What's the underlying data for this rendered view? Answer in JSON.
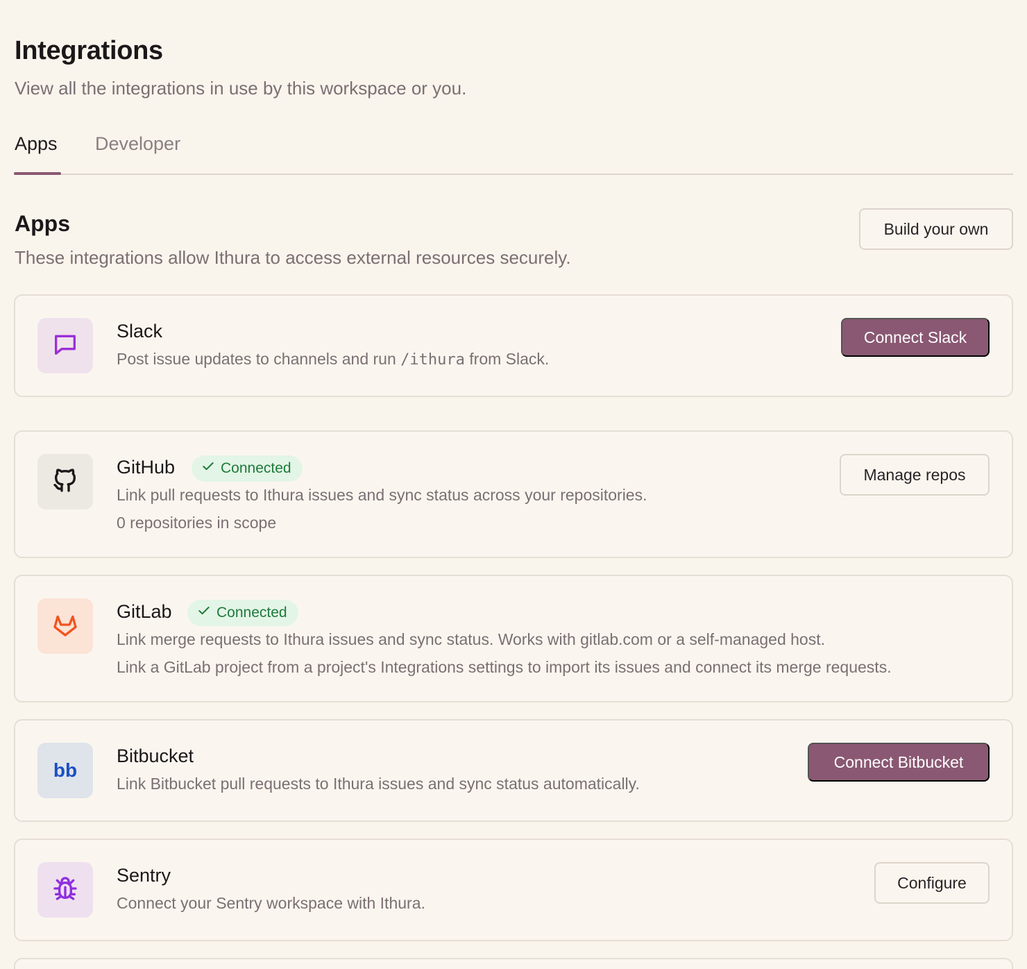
{
  "header": {
    "title": "Integrations",
    "subtitle": "View all the integrations in use by this workspace or you."
  },
  "tabs": [
    {
      "label": "Apps",
      "active": true
    },
    {
      "label": "Developer",
      "active": false
    }
  ],
  "section": {
    "title": "Apps",
    "subtitle": "These integrations allow Ithura to access external resources securely.",
    "build_button": "Build your own"
  },
  "integrations": {
    "slack": {
      "name": "Slack",
      "icon": "message-square-icon",
      "desc_before": "Post issue updates to channels and run ",
      "desc_code": "/ithura",
      "desc_after": " from Slack.",
      "action": "Connect Slack"
    },
    "github": {
      "name": "GitHub",
      "icon": "github-icon",
      "status": "Connected",
      "desc": "Link pull requests to Ithura issues and sync status across your repositories.",
      "detail": "0 repositories in scope",
      "action": "Manage repos"
    },
    "gitlab": {
      "name": "GitLab",
      "icon": "gitlab-icon",
      "status": "Connected",
      "desc": "Link merge requests to Ithura issues and sync status. Works with gitlab.com or a self-managed host.",
      "detail": "Link a GitLab project from a project's Integrations settings to import its issues and connect its merge requests."
    },
    "bitbucket": {
      "name": "Bitbucket",
      "icon_text": "bb",
      "desc": "Link Bitbucket pull requests to Ithura issues and sync status automatically.",
      "action": "Connect Bitbucket"
    },
    "sentry": {
      "name": "Sentry",
      "icon": "bug-icon",
      "desc": "Connect your Sentry workspace with Ithura.",
      "action": "Configure"
    }
  },
  "colors": {
    "background": "#f9f4ec",
    "accent": "#8a5873",
    "success_bg": "#e3f5e6",
    "success_text": "#1e7a3c"
  }
}
